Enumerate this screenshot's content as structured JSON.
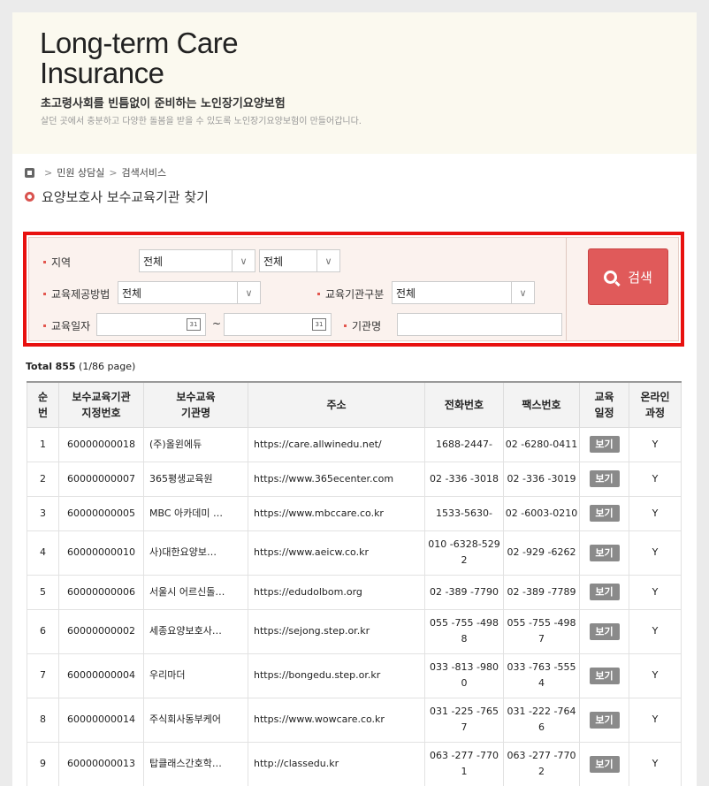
{
  "banner": {
    "title_line1": "Long-term Care",
    "title_line2": "Insurance",
    "subtitle": "초고령사회를 빈틈없이 준비하는 노인장기요양보험",
    "description": "살던 곳에서 충분하고 다양한 돌봄을 받을 수 있도록 노인장기요양보험이 만들어갑니다."
  },
  "breadcrumb": {
    "item1": "민원 상담실",
    "item2": "검색서비스"
  },
  "page_title": "요양보호사 보수교육기관 찾기",
  "search": {
    "region_label": "지역",
    "region_value1": "전체",
    "region_value2": "전체",
    "method_label": "교육제공방법",
    "method_value": "전체",
    "type_label": "교육기관구분",
    "type_value": "전체",
    "date_label": "교육일자",
    "date_separator": "~",
    "org_label": "기관명",
    "search_button": "검색",
    "calendar_glyph": "31"
  },
  "total": {
    "label": "Total",
    "count": "855",
    "page_info": "(1/86 page)"
  },
  "table": {
    "headers": {
      "no": [
        "순",
        "번"
      ],
      "code": [
        "보수교육기관",
        "지정번호"
      ],
      "name": [
        "보수교육",
        "기관명"
      ],
      "address": "주소",
      "phone": "전화번호",
      "fax": "팩스번호",
      "schedule": [
        "교육",
        "일정"
      ],
      "online": [
        "온라인",
        "과정"
      ]
    },
    "view_label": "보기",
    "rows": [
      {
        "no": "1",
        "code": "60000000018",
        "name": "(주)올윈에듀",
        "address": "https://care.allwinedu.net/",
        "phone": [
          "1688-2447-"
        ],
        "fax": [
          "02 -6280-0411"
        ],
        "online": "Y"
      },
      {
        "no": "2",
        "code": "60000000007",
        "name": "365평생교육원",
        "address": "https://www.365ecenter.com",
        "phone": [
          "02 -336 -3018"
        ],
        "fax": [
          "02 -336 -3019"
        ],
        "online": "Y"
      },
      {
        "no": "3",
        "code": "60000000005",
        "name": "MBC 아카데미 …",
        "address": "https://www.mbccare.co.kr",
        "phone": [
          "1533-5630-"
        ],
        "fax": [
          "02 -6003-0210"
        ],
        "online": "Y"
      },
      {
        "no": "4",
        "code": "60000000010",
        "name": "사)대한요양보…",
        "address": "https://www.aeicw.co.kr",
        "phone": [
          "010 -6328-529",
          "2"
        ],
        "fax": [
          "02 -929 -6262"
        ],
        "online": "Y"
      },
      {
        "no": "5",
        "code": "60000000006",
        "name": "서울시 어르신돌…",
        "address": "https://edudolbom.org",
        "phone": [
          "02 -389 -7790"
        ],
        "fax": [
          "02 -389 -7789"
        ],
        "online": "Y"
      },
      {
        "no": "6",
        "code": "60000000002",
        "name": "세종요양보호사…",
        "address": "https://sejong.step.or.kr",
        "phone": [
          "055 -755 -498",
          "8"
        ],
        "fax": [
          "055 -755 -498",
          "7"
        ],
        "online": "Y"
      },
      {
        "no": "7",
        "code": "60000000004",
        "name": "우리마더",
        "address": "https://bongedu.step.or.kr",
        "phone": [
          "033 -813 -980",
          "0"
        ],
        "fax": [
          "033 -763 -555",
          "4"
        ],
        "online": "Y"
      },
      {
        "no": "8",
        "code": "60000000014",
        "name": "주식회사동부케어",
        "address": "https://www.wowcare.co.kr",
        "phone": [
          "031 -225 -765",
          "7"
        ],
        "fax": [
          "031 -222 -764",
          "6"
        ],
        "online": "Y"
      },
      {
        "no": "9",
        "code": "60000000013",
        "name": "탑클래스간호학…",
        "address": "http://classedu.kr",
        "phone": [
          "063 -277 -770",
          "1"
        ],
        "fax": [
          "063 -277 -770",
          "2"
        ],
        "online": "Y"
      }
    ]
  },
  "colors": {
    "accent": "#e05a5a",
    "highlight_border": "#e8110f",
    "banner_bg": "#fbf9ef",
    "search_bg": "#fbf2ee"
  },
  "icons": {
    "home": "home-icon",
    "search": "search-icon",
    "calendar": "calendar-icon",
    "dropdown": "chevron-down-icon"
  }
}
